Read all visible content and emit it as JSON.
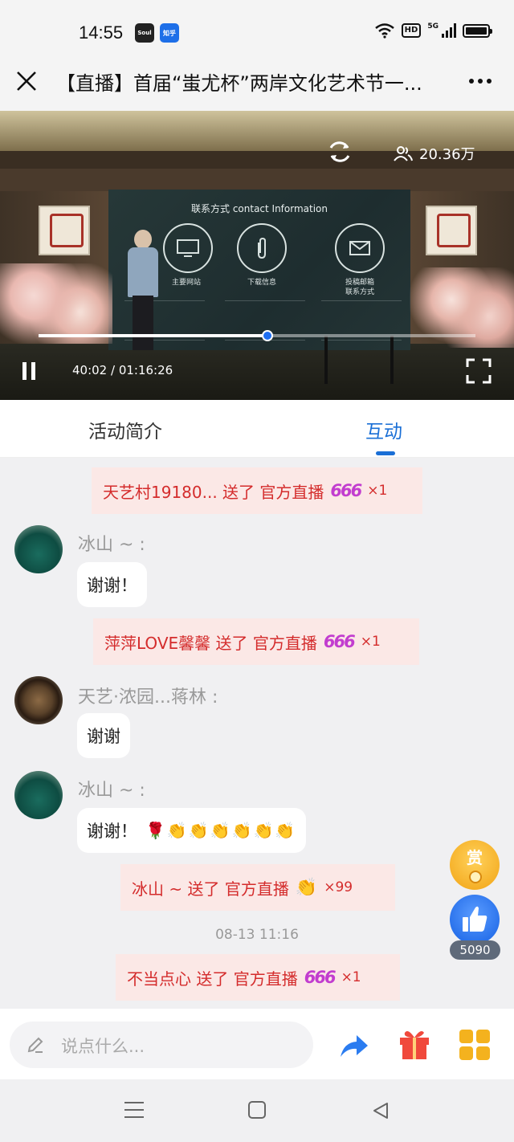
{
  "status_bar": {
    "time": "14:55",
    "app_icon_1": "Soul",
    "app_icon_2": "知乎",
    "hd_label": "HD",
    "network_label": "5G"
  },
  "header": {
    "title": "【直播】首届“蚩尤杯”两岸文化艺术节一..."
  },
  "video": {
    "screen_title": "联系方式 contact Information",
    "screen_labels": [
      "主要网站",
      "下载信息",
      "投稿邮箱\n联系方式"
    ],
    "viewers": "20.36万",
    "time_display": "40:02 / 01:16:26",
    "progress_fraction": 0.523
  },
  "tabs": {
    "intro": "活动简介",
    "interact": "互动"
  },
  "chat": {
    "gifts": [
      {
        "text": "天艺村19180... 送了 官方直播",
        "gift": "666",
        "count": "×1"
      },
      {
        "text": "萍萍LOVE馨馨 送了 官方直播",
        "gift": "666",
        "count": "×1"
      },
      {
        "text": "冰山 ~ 送了 官方直播",
        "gift": "clap",
        "count": "×99"
      },
      {
        "text": "不当点心 送了 官方直播",
        "gift": "666",
        "count": "×1"
      }
    ],
    "messages": [
      {
        "user": "冰山 ~ :",
        "text": "谢谢！",
        "emoji": ""
      },
      {
        "user": "天艺·浓园...蒋林 :",
        "text": "谢谢",
        "emoji": ""
      },
      {
        "user": "冰山 ~ :",
        "text": "谢谢！",
        "emoji": "🌹👏👏👏👏👏👏"
      }
    ],
    "timestamp": "08-13 11:16"
  },
  "side": {
    "reward_label": "赏",
    "like_count": "5090"
  },
  "bottom": {
    "comment_placeholder": "说点什么..."
  },
  "colors": {
    "accent": "#1a6fd6",
    "gift_text": "#d42c2c",
    "gift_bg": "#fbe8e6",
    "reward": "#f3a81c",
    "like": "#1c66e6"
  },
  "icons": {
    "close": "close-icon",
    "more": "more-icon",
    "refresh": "refresh-icon",
    "viewers": "people-icon",
    "pause": "pause-icon",
    "fullscreen": "fullscreen-icon",
    "share": "share-icon",
    "gift": "gift-icon",
    "apps": "apps-icon"
  }
}
